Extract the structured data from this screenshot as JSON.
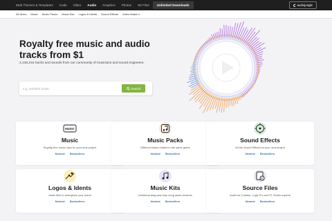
{
  "topnav": {
    "items": [
      "Web Themes & Templates",
      "Code",
      "Video",
      "Audio",
      "Graphics",
      "Photos",
      "3D Files"
    ],
    "active": "Audio",
    "highlight": "Unlimited Downloads"
  },
  "brand": {
    "label": "audiojungle"
  },
  "subnav": {
    "items": [
      "All Items",
      "Music",
      "Music Packs",
      "Music Kits",
      "Logos & Idents",
      "Sound Effects",
      "Video Maker"
    ]
  },
  "hero": {
    "title": "Royalty free music and audio tracks from $1",
    "subtitle": "2,138,216 tracks and sounds from our community of musicians and sound engineers."
  },
  "search": {
    "placeholder": "e.g. ambient music",
    "button_label": "Search"
  },
  "cards": [
    {
      "title": "Music",
      "desc": "Royalty-free music clips for your next project",
      "newest": "Newest",
      "bestsellers": "Bestsellers",
      "icon": "music-badge-icon",
      "icon_text": "MUSIC"
    },
    {
      "title": "Music Packs",
      "desc": "Different tracks related to the same genre",
      "newest": "Newest",
      "bestsellers": "Bestsellers",
      "icon": "music-pack-icon"
    },
    {
      "title": "Sound Effects",
      "desc": "All the Sound Effects for your next project",
      "newest": "Newest",
      "bestsellers": "Bestsellers",
      "icon": "sound-effects-icon"
    },
    {
      "title": "Logos & Idents",
      "desc": "Audio files to strengthen your brand",
      "newest": "Newest",
      "bestsellers": "Bestsellers",
      "icon": "logo-idents-icon"
    },
    {
      "title": "Music Kits",
      "desc": "Individual drag-and-drop song audio sections",
      "newest": "Newest",
      "bestsellers": "Bestsellers",
      "icon": "music-kits-icon"
    },
    {
      "title": "Source Files",
      "desc": "Audio for Cubase, Logic Pro and FL Studio experts",
      "newest": "Newest",
      "bestsellers": "Bestsellers",
      "icon": "source-files-icon"
    }
  ],
  "colors": {
    "topbar": "#1f1f1f",
    "accent_green": "#82b541",
    "link_blue": "#2f6fb5",
    "background": "#f3f3f6",
    "wave_purple": "#b06ae0",
    "wave_orange": "#f0a15c",
    "wave_blue": "#6f9cf0"
  }
}
